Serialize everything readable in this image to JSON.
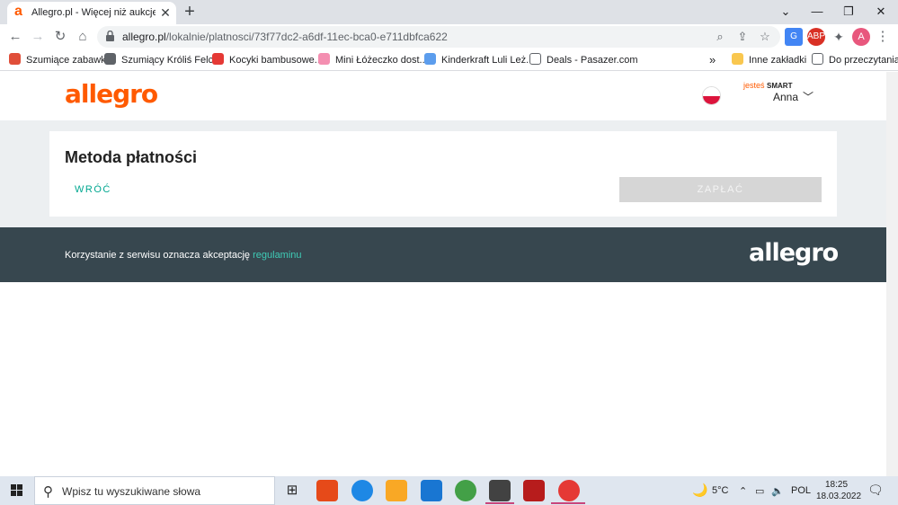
{
  "browser": {
    "tab_title": "Allegro.pl - Więcej niż aukcje. Na",
    "url_domain": "allegro.pl",
    "url_path": "/lokalnie/platnosci/73f77dc2-a6df-11ec-bca0-e711dbfca622",
    "profile_initial": "A"
  },
  "bookmarks": [
    {
      "label": "Szumiące zabawki",
      "icon_color": "#e04e39"
    },
    {
      "label": "Szumiący Króliś Felc...",
      "icon_color": "#5f6368"
    },
    {
      "label": "Kocyki bambusowe...",
      "icon_color": "#e53935"
    },
    {
      "label": "Mini Łóżeczko dost...",
      "icon_color": "#f48fb1"
    },
    {
      "label": "Kinderkraft Luli Leż...",
      "icon_color": "#5c9ded"
    },
    {
      "label": "Deals - Pasazer.com",
      "icon_color": "#5f6368"
    }
  ],
  "bookmarks_overflow": "»",
  "other_bookmarks": "Inne zakładki",
  "reading_list": "Do przeczytania",
  "site": {
    "logo": "allegro",
    "smart_prefix": "jesteś",
    "smart_label": "SMART",
    "user_name": "Anna",
    "page_title": "Metoda płatności",
    "back_label": "WRÓĆ",
    "pay_label": "ZAPŁAĆ",
    "footer_text": "Korzystanie z serwisu oznacza akceptację",
    "footer_link": "regulaminu",
    "footer_logo": "allegro"
  },
  "taskbar": {
    "search_placeholder": "Wpisz tu wyszukiwane słowa",
    "weather": "5°C",
    "language": "POL",
    "time": "18:25",
    "date": "18.03.2022"
  },
  "colors": {
    "brand_orange": "#ff5a00",
    "teal": "#00a790",
    "footer_bg": "#37474f"
  }
}
